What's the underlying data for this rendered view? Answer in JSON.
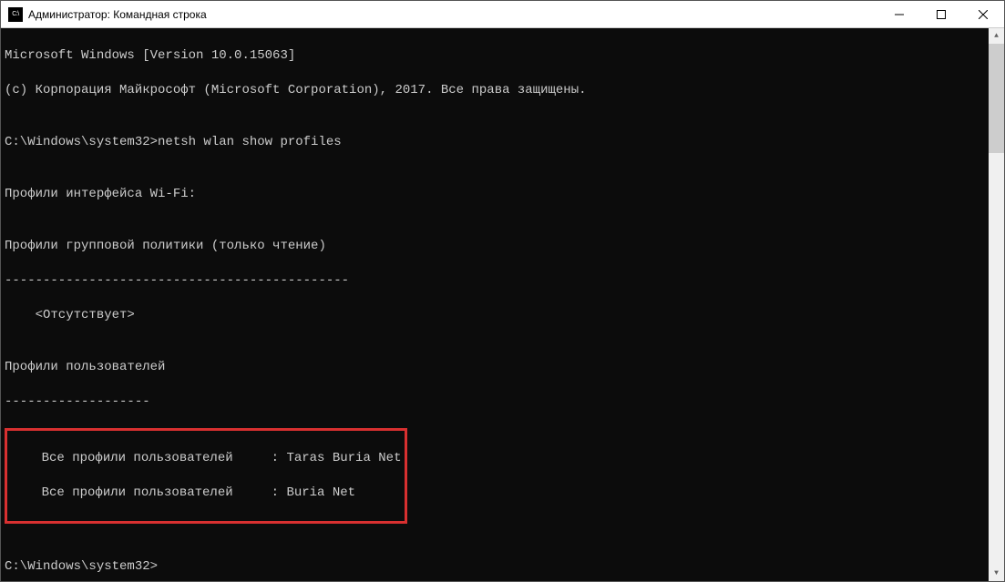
{
  "titlebar": {
    "icon_text": "C:\\",
    "title": "Администратор: Командная строка"
  },
  "terminal": {
    "line1": "Microsoft Windows [Version 10.0.15063]",
    "line2": "(c) Корпорация Майкрософт (Microsoft Corporation), 2017. Все права защищены.",
    "blank1": "",
    "prompt1": "C:\\Windows\\system32>netsh wlan show profiles",
    "blank2": "",
    "header_interface": "Профили интерфейса Wi-Fi:",
    "blank3": "",
    "header_group": "Профили групповой политики (только чтение)",
    "dashes1": "---------------------------------------------",
    "absent": "    <Отсутствует>",
    "blank4": "",
    "header_user": "Профили пользователей",
    "dashes2": "-------------------",
    "profile1": "    Все профили пользователей     : Taras Buria Net",
    "profile2": "    Все профили пользователей     : Buria Net",
    "blank5": "",
    "blank6": "",
    "prompt2": "C:\\Windows\\system32>"
  }
}
